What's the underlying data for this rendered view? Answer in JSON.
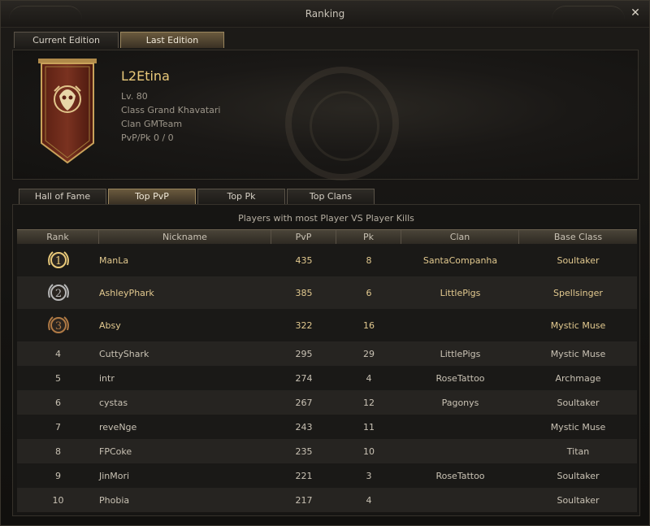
{
  "window": {
    "title": "Ranking"
  },
  "tabs": [
    "Current Edition",
    "Last Edition"
  ],
  "active_tab": 1,
  "profile": {
    "name": "L2Etina",
    "level": "Lv. 80",
    "class": "Class Grand Khavatari",
    "clan": "Clan GMTeam",
    "pvp_pk": "PvP/Pk 0 / 0"
  },
  "subtabs": [
    "Hall of Fame",
    "Top PvP",
    "Top Pk",
    "Top Clans"
  ],
  "active_subtab": 1,
  "table": {
    "caption": "Players with most Player VS Player Kills",
    "headers": [
      "Rank",
      "Nickname",
      "PvP",
      "Pk",
      "Clan",
      "Base Class"
    ],
    "rows": [
      {
        "rank": "1",
        "nickname": "ManLa",
        "pvp": "435",
        "pk": "8",
        "clan": "SantaCompanha",
        "base_class": "Soultaker"
      },
      {
        "rank": "2",
        "nickname": "AshleyPhark",
        "pvp": "385",
        "pk": "6",
        "clan": "LittlePigs",
        "base_class": "Spellsinger"
      },
      {
        "rank": "3",
        "nickname": "Absy",
        "pvp": "322",
        "pk": "16",
        "clan": "",
        "base_class": "Mystic Muse"
      },
      {
        "rank": "4",
        "nickname": "CuttyShark",
        "pvp": "295",
        "pk": "29",
        "clan": "LittlePigs",
        "base_class": "Mystic Muse"
      },
      {
        "rank": "5",
        "nickname": "intr",
        "pvp": "274",
        "pk": "4",
        "clan": "RoseTattoo",
        "base_class": "Archmage"
      },
      {
        "rank": "6",
        "nickname": "cystas",
        "pvp": "267",
        "pk": "12",
        "clan": "Pagonys",
        "base_class": "Soultaker"
      },
      {
        "rank": "7",
        "nickname": "reveNge",
        "pvp": "243",
        "pk": "11",
        "clan": "",
        "base_class": "Mystic Muse"
      },
      {
        "rank": "8",
        "nickname": "FPCoke",
        "pvp": "235",
        "pk": "10",
        "clan": "",
        "base_class": "Titan"
      },
      {
        "rank": "9",
        "nickname": "JinMori",
        "pvp": "221",
        "pk": "3",
        "clan": "RoseTattoo",
        "base_class": "Soultaker"
      },
      {
        "rank": "10",
        "nickname": "Phobia",
        "pvp": "217",
        "pk": "4",
        "clan": "",
        "base_class": "Soultaker"
      }
    ]
  },
  "colors": {
    "gold": "#e9c97a",
    "silver": "#b8b8b8",
    "bronze": "#b07a45",
    "text": "#c9c2b4"
  },
  "icons": {
    "close": "close-icon",
    "banner": "clan-banner-icon",
    "medal": "rank-medal-icon"
  }
}
